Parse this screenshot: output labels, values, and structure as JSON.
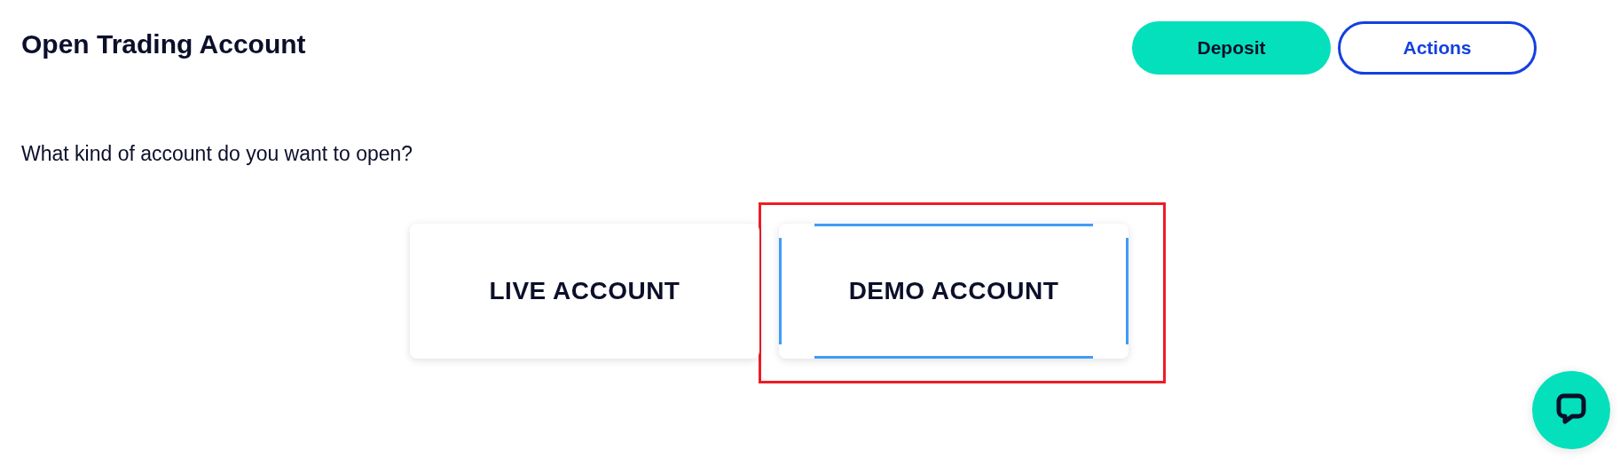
{
  "header": {
    "title": "Open Trading Account",
    "buttons": [
      {
        "label": "Deposit",
        "kind": "primary"
      },
      {
        "label": "Actions",
        "kind": "outline"
      }
    ]
  },
  "question": "What kind of account do you want to open?",
  "account_types": [
    {
      "label": "LIVE ACCOUNT",
      "selected": false,
      "highlighted": false
    },
    {
      "label": "DEMO ACCOUNT",
      "selected": true,
      "highlighted": true
    }
  ],
  "chat": {
    "kind": "chat"
  }
}
